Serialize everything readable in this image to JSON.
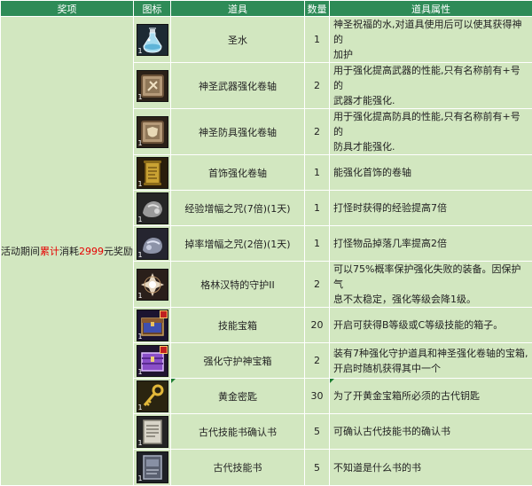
{
  "headers": {
    "award": "奖项",
    "icon": "图标",
    "item": "道具",
    "qty": "数量",
    "attr": "道具属性"
  },
  "award": {
    "prefix": "活动期间",
    "highlight1": "累计",
    "mid": "消耗",
    "highlight2": "2999",
    "suffix": "元奖励"
  },
  "icon_count": "1",
  "colors": {
    "header_bg": "#2e8b57",
    "cell_bg": "#d2e7c0",
    "highlight": "#e60000"
  },
  "rows": [
    {
      "icon": "holy-water-bottle-icon",
      "name": "圣水",
      "qty": "1",
      "attr1": "神圣祝福的水,对道具使用后可以使其获得神的",
      "attr2": "加护"
    },
    {
      "icon": "holy-weapon-scroll-icon",
      "name": "神圣武器强化卷轴",
      "qty": "2",
      "attr1": "用于强化提高武器的性能,只有名称前有+号的",
      "attr2": "武器才能强化."
    },
    {
      "icon": "holy-armor-scroll-icon",
      "name": "神圣防具强化卷轴",
      "qty": "2",
      "attr1": "用于强化提高防具的性能,只有名称前有+号的",
      "attr2": "防具才能强化."
    },
    {
      "icon": "accessory-scroll-icon",
      "name": "首饰强化卷轴",
      "qty": "1",
      "attr1": "能强化首饰的卷轴",
      "attr2": ""
    },
    {
      "icon": "exp-boost-icon",
      "name": "经验增幅之咒(7倍)(1天)",
      "qty": "1",
      "attr1": "打怪时获得的经验提高7倍",
      "attr2": ""
    },
    {
      "icon": "drop-rate-icon",
      "name": "掉率增幅之咒(2倍)(1天)",
      "qty": "1",
      "attr1": "打怪物品掉落几率提高2倍",
      "attr2": ""
    },
    {
      "icon": "greenwich-guard-icon",
      "name": "格林汉特的守护II",
      "qty": "2",
      "attr1": "可以75%概率保护强化失败的装备。因保护气",
      "attr2": "息不太稳定，强化等级会降1级。"
    },
    {
      "icon": "skill-chest-icon",
      "name": "技能宝箱",
      "qty": "20",
      "attr1": "开启可获得B等级或C等级技能的箱子。",
      "attr2": ""
    },
    {
      "icon": "enhance-guard-chest-icon",
      "name": "强化守护神宝箱",
      "qty": "2",
      "attr1": "装有7种强化守护道具和神圣强化卷轴的宝箱,",
      "attr2": "开启时随机获得其中一个"
    },
    {
      "icon": "golden-key-icon",
      "name": "黄金密匙",
      "qty": "30",
      "attr1": "为了开黄金宝箱所必须的古代钥匙",
      "attr2": ""
    },
    {
      "icon": "ancient-book-confirm-icon",
      "name": "古代技能书确认书",
      "qty": "5",
      "attr1": "可确认古代技能书的确认书",
      "attr2": ""
    },
    {
      "icon": "ancient-skill-book-icon",
      "name": "古代技能书",
      "qty": "5",
      "attr1": "不知道是什么书的书",
      "attr2": ""
    }
  ]
}
